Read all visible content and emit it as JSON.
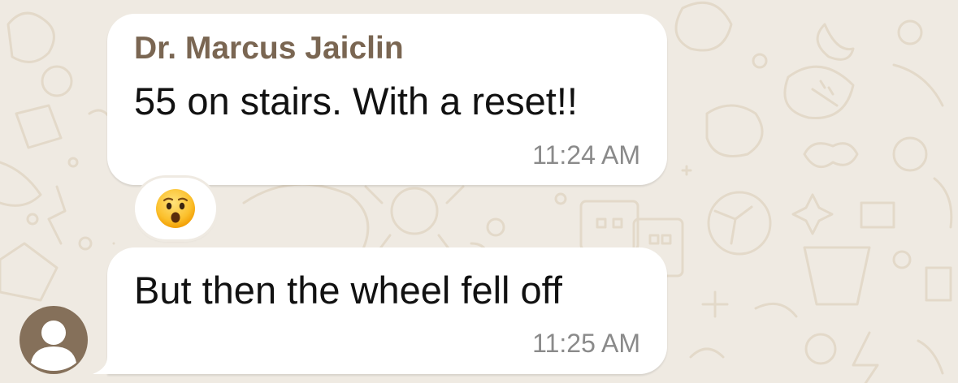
{
  "colors": {
    "wallpaper": "#efeae2",
    "bubble": "#ffffff",
    "sender_name": "#7a6652",
    "timestamp": "#8a8a8a",
    "avatar": "#85705a"
  },
  "messages": [
    {
      "sender": "Dr. Marcus Jaiclin",
      "text": "55 on stairs.  With a reset!!",
      "time": "11:24 AM",
      "reaction": {
        "icon": "astonished-face-emoji"
      }
    },
    {
      "text": "But then the wheel fell off",
      "time": "11:25 AM"
    }
  ],
  "avatar": {
    "icon": "person-silhouette-icon"
  }
}
